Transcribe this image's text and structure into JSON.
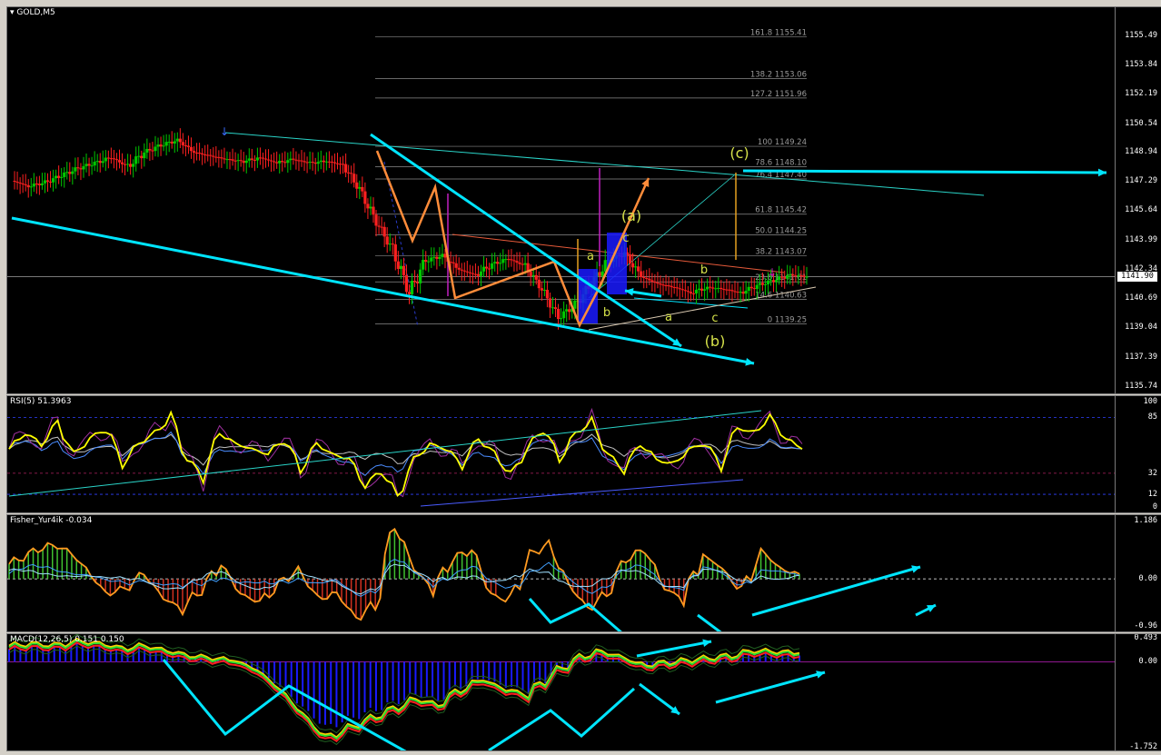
{
  "window": {
    "symbol": "GOLD,M5"
  },
  "main": {
    "current_price": "1141.90",
    "price_ticks": [
      "1155.49",
      "1153.84",
      "1152.19",
      "1150.54",
      "1148.94",
      "1147.29",
      "1145.64",
      "1143.99",
      "1142.34",
      "1140.69",
      "1139.04",
      "1137.39",
      "1135.74"
    ],
    "fib_levels": [
      {
        "label": "161.8 1155.41",
        "price": 1155.41
      },
      {
        "label": "138.2 1153.06",
        "price": 1153.06
      },
      {
        "label": "127.2 1151.96",
        "price": 1151.96
      },
      {
        "label": "100 1149.24",
        "price": 1149.24
      },
      {
        "label": "78.6 1148.10",
        "price": 1148.1
      },
      {
        "label": "76.4 1147.40",
        "price": 1147.4
      },
      {
        "label": "61.8 1145.42",
        "price": 1145.42
      },
      {
        "label": "50.0 1144.25",
        "price": 1144.25
      },
      {
        "label": "38.2 1143.07",
        "price": 1143.07
      },
      {
        "label": "23.6 1141.61",
        "price": 1141.61
      },
      {
        "label": "14.6 1140.63",
        "price": 1140.63
      },
      {
        "label": "0 1139.25",
        "price": 1139.25
      }
    ],
    "wave_labels": [
      "(a)",
      "(b)",
      "(c)",
      "a",
      "b",
      "c",
      "a",
      "b",
      "c"
    ]
  },
  "rsi": {
    "title": "RSI(5) 51.3963",
    "levels": [
      "100",
      "85",
      "32",
      "12",
      "0"
    ]
  },
  "fisher": {
    "title": "Fisher_Yur4ik -0.034",
    "levels": [
      "1.186",
      "0.00",
      "-0.96"
    ]
  },
  "macd": {
    "title": "MACD(12,26,5) 0.151 0.150",
    "levels": [
      "0.493",
      "0.00",
      "-1.752"
    ]
  },
  "colors": {
    "bull": "#00c800",
    "bear": "#ff2020",
    "rsi": "#ffff00",
    "cyan": "#00e5ff",
    "orange": "#ff8c3a",
    "fib": "#8a8a8a",
    "wave": "#d6e24a",
    "hist": "#1a1aff"
  },
  "chart_data": [
    {
      "type": "line",
      "title": "GOLD,M5",
      "xlabel": "",
      "ylabel": "",
      "ylim": [
        1135.74,
        1156.5
      ],
      "series": [
        {
          "values": [
            1147.3,
            1147.0,
            1147.2,
            1147.6,
            1148.0,
            1148.3,
            1148.6,
            1148.1,
            1148.9,
            1149.3,
            1149.6,
            1148.9,
            1148.7,
            1148.5,
            1148.4,
            1148.6,
            1148.3,
            1148.5,
            1148.3,
            1148.4,
            1148.2,
            1146.8,
            1145.0,
            1143.4,
            1141.0,
            1142.8,
            1143.1,
            1142.3,
            1142.0,
            1142.6,
            1142.9,
            1142.5,
            1141.2,
            1139.6,
            1140.3,
            1141.5,
            1142.8,
            1143.2,
            1141.9,
            1141.5,
            1141.3,
            1141.0,
            1141.3,
            1141.2,
            1141.0,
            1141.4,
            1141.7,
            1142.0,
            1141.9
          ]
        }
      ]
    },
    {
      "type": "line",
      "title": "RSI(5) 51.3963",
      "ylim": [
        0,
        100
      ],
      "series": [
        {
          "values": [
            55,
            70,
            60,
            80,
            50,
            65,
            75,
            40,
            60,
            70,
            85,
            45,
            30,
            70,
            60,
            55,
            50,
            65,
            35,
            60,
            50,
            45,
            20,
            35,
            10,
            45,
            60,
            55,
            40,
            65,
            50,
            30,
            55,
            75,
            45,
            70,
            80,
            50,
            35,
            60,
            45,
            40,
            55,
            60,
            40,
            75,
            70,
            85,
            65,
            55
          ]
        }
      ]
    },
    {
      "type": "bar",
      "title": "Fisher_Yur4ik -0.034",
      "ylim": [
        -0.96,
        1.186
      ],
      "series": [
        {
          "values": [
            0.3,
            0.5,
            0.7,
            0.6,
            0.2,
            -0.3,
            -0.2,
            0.1,
            -0.4,
            -0.6,
            -0.2,
            0.3,
            -0.3,
            -0.5,
            -0.1,
            0.2,
            -0.4,
            -0.3,
            -0.8,
            -0.5,
            1.1,
            0.2,
            -0.2,
            0.4,
            0.6,
            -0.3,
            -0.5,
            0.5,
            0.7,
            -0.1,
            -0.6,
            -0.3,
            0.4,
            0.6,
            -0.2,
            -0.4,
            0.5,
            0.2,
            -0.3,
            0.6,
            0.2,
            0.1
          ]
        }
      ]
    },
    {
      "type": "line",
      "title": "MACD(12,26,5) 0.151 0.150",
      "ylim": [
        -1.752,
        0.493
      ],
      "series": [
        {
          "values": [
            0.3,
            0.35,
            0.3,
            0.4,
            0.35,
            0.25,
            0.3,
            0.2,
            0.1,
            0.05,
            0.0,
            -0.2,
            -0.6,
            -1.1,
            -1.6,
            -1.4,
            -1.2,
            -1.0,
            -0.8,
            -0.9,
            -0.6,
            -0.4,
            -0.6,
            -0.7,
            -0.3,
            0.0,
            0.2,
            0.1,
            -0.1,
            -0.05,
            0.0,
            0.05,
            0.1,
            0.2,
            0.18,
            0.15
          ]
        }
      ]
    }
  ]
}
